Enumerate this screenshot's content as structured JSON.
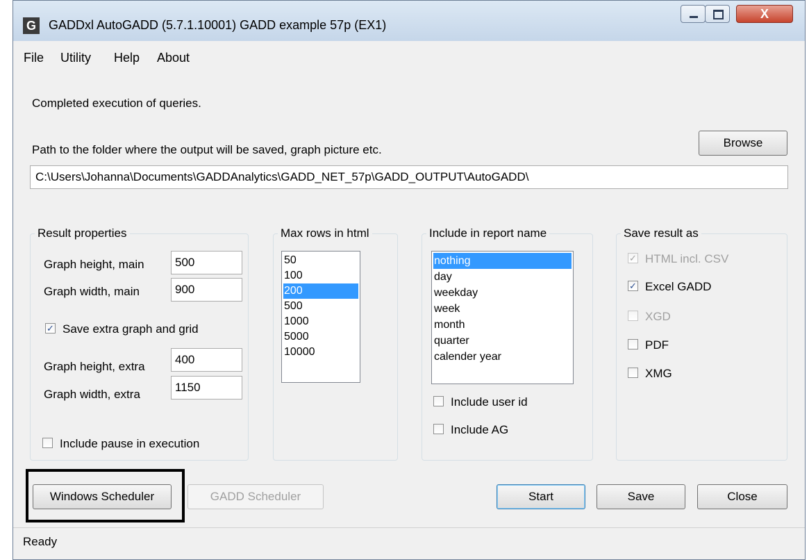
{
  "window": {
    "title": "GADDxl AutoGADD (5.7.1.10001) GADD example 57p (EX1)",
    "app_icon": "G",
    "close_glyph": "X"
  },
  "menu": [
    "File",
    "Utility",
    "Help",
    "About"
  ],
  "status_message": "Completed execution of queries.",
  "path": {
    "label": "Path to the folder where the output will be saved, graph picture etc.",
    "browse_label": "Browse",
    "value": "C:\\Users\\Johanna\\Documents\\GADDAnalytics\\GADD_NET_57p\\GADD_OUTPUT\\AutoGADD\\"
  },
  "result_properties": {
    "legend": "Result properties",
    "graph_height_main_label": "Graph height, main",
    "graph_height_main": "500",
    "graph_width_main_label": "Graph width, main",
    "graph_width_main": "900",
    "save_extra_label": "Save extra graph and grid",
    "save_extra_checked": true,
    "graph_height_extra_label": "Graph height, extra",
    "graph_height_extra": "400",
    "graph_width_extra_label": "Graph width, extra",
    "graph_width_extra": "1150",
    "include_pause_label": "Include pause in execution",
    "include_pause_checked": false
  },
  "max_rows": {
    "legend": "Max rows in html",
    "options": [
      "50",
      "100",
      "200",
      "500",
      "1000",
      "5000",
      "10000"
    ],
    "selected": "200"
  },
  "report_name": {
    "legend": "Include in report name",
    "options": [
      "nothing",
      "day",
      "weekday",
      "week",
      "month",
      "quarter",
      "calender year"
    ],
    "selected": "nothing",
    "include_user_id_label": "Include user id",
    "include_ag_label": "Include AG"
  },
  "save_result_as": {
    "legend": "Save result as",
    "html_csv_label": "HTML incl. CSV",
    "excel_label": "Excel GADD",
    "xgd_label": "XGD",
    "pdf_label": "PDF",
    "xmg_label": "XMG"
  },
  "buttons": {
    "windows_scheduler": "Windows Scheduler",
    "gadd_scheduler": "GADD Scheduler",
    "start": "Start",
    "save": "Save",
    "close": "Close"
  },
  "check_mark": "✓",
  "status_bar": "Ready",
  "colors": {
    "selection": "#3399ff",
    "window_bg": "#f0f0f0",
    "close_button": "#c7442d"
  }
}
